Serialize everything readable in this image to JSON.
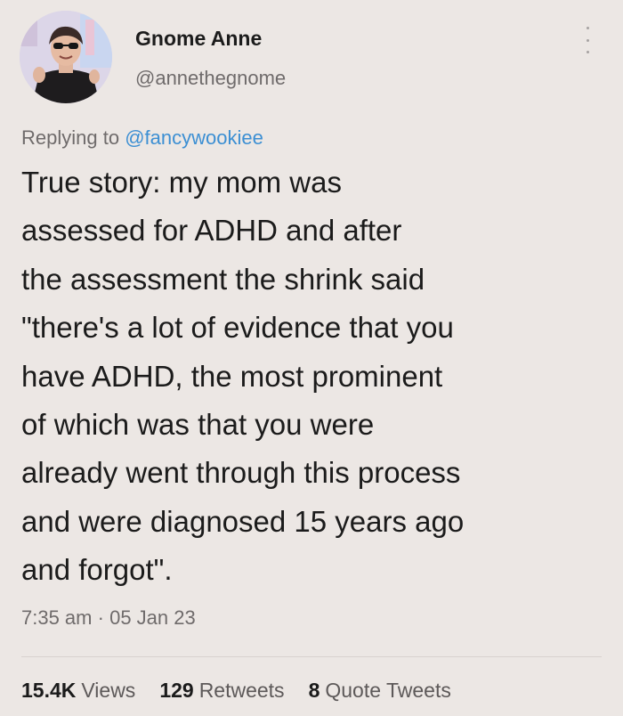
{
  "author": {
    "name": "Gnome Anne",
    "handle": "@annethegnome"
  },
  "reply": {
    "prefix": "Replying to",
    "mention": "@fancywookiee"
  },
  "tweet": {
    "lines": [
      "True story: my mom was",
      "assessed for ADHD and after",
      "the assessment the shrink said",
      "\"there's a lot of evidence that you",
      "have ADHD, the most prominent",
      "of which was that you were",
      "already went through this process",
      "and were diagnosed 15 years ago",
      "and forgot\"."
    ]
  },
  "meta": {
    "time": "7:35 am",
    "separator": "·",
    "date": "05 Jan 23"
  },
  "stats": {
    "views_count": "15.4K",
    "views_label": "Views",
    "retweets_count": "129",
    "retweets_label": "Retweets",
    "quotes_count": "8",
    "quotes_label": "Quote Tweets"
  },
  "colors": {
    "background": "#ece7e4",
    "mention": "#3c8fd3",
    "secondary_text": "#6f6b6b"
  },
  "icons": {
    "more": "more-vertical-icon"
  }
}
